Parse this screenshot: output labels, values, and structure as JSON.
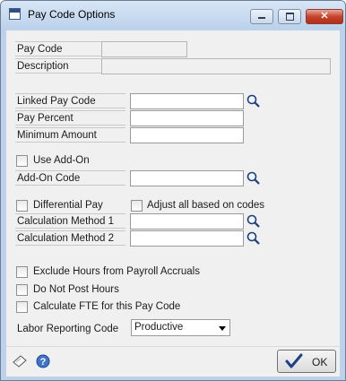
{
  "window": {
    "title": "Pay Code Options"
  },
  "fields": {
    "pay_code": {
      "label": "Pay Code",
      "value": ""
    },
    "description": {
      "label": "Description",
      "value": ""
    },
    "linked_pay_code": {
      "label": "Linked Pay Code",
      "value": ""
    },
    "pay_percent": {
      "label": "Pay Percent",
      "value": ""
    },
    "minimum_amount": {
      "label": "Minimum Amount",
      "value": ""
    },
    "add_on_code": {
      "label": "Add-On Code",
      "value": ""
    },
    "calc_method_1": {
      "label": "Calculation Method 1",
      "value": ""
    },
    "calc_method_2": {
      "label": "Calculation Method 2",
      "value": ""
    },
    "labor_reporting_code": {
      "label": "Labor Reporting Code",
      "value": "Productive"
    }
  },
  "checkboxes": {
    "use_add_on": {
      "label": "Use Add-On",
      "checked": false
    },
    "differential_pay": {
      "label": "Differential Pay",
      "checked": false
    },
    "adjust_all": {
      "label": "Adjust all based on codes",
      "checked": false
    },
    "exclude_hours": {
      "label": "Exclude Hours from Payroll Accruals",
      "checked": false
    },
    "do_not_post": {
      "label": "Do Not Post Hours",
      "checked": false
    },
    "calculate_fte": {
      "label": "Calculate FTE for this Pay Code",
      "checked": false
    }
  },
  "buttons": {
    "ok": "OK"
  },
  "icons": {
    "window": "window-icon",
    "minimize": "minimize-icon",
    "maximize": "maximize-icon",
    "close": "close-icon",
    "lookup": "lookup-magnifier-icon",
    "note": "note-icon",
    "help": "help-icon",
    "ok": "checkmark-icon"
  },
  "colors": {
    "frame": "#bcd2eb",
    "client": "#f0f0f0",
    "close_button": "#c7432e",
    "accent": "#2a5bb5"
  }
}
